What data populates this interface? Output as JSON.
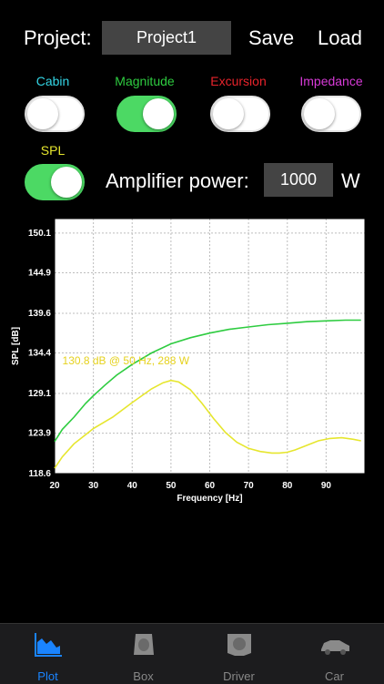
{
  "project": {
    "label": "Project:",
    "name": "Project1",
    "save_label": "Save",
    "load_label": "Load"
  },
  "toggles": [
    {
      "label": "Cabin",
      "color": "#33d6e6",
      "on": false
    },
    {
      "label": "Magnitude",
      "color": "#2ecc40",
      "on": true
    },
    {
      "label": "Excursion",
      "color": "#e8232b",
      "on": false
    },
    {
      "label": "Impedance",
      "color": "#d93bd9",
      "on": false
    },
    {
      "label": "SPL",
      "color": "#e6e62e",
      "on": true
    }
  ],
  "amplifier": {
    "label": "Amplifier power:",
    "value": "1000",
    "unit": "W"
  },
  "chart_data": {
    "type": "line",
    "xlabel": "Frequency [Hz]",
    "ylabel": "SPL [dB]",
    "xlim": [
      20,
      100
    ],
    "ylim": [
      118.6,
      152.0
    ],
    "xticks": [
      20,
      30,
      40,
      50,
      60,
      70,
      80,
      90
    ],
    "yticks": [
      118.6,
      123.9,
      129.1,
      134.4,
      139.6,
      144.9,
      150.1
    ],
    "grid": true,
    "annotation": "130.8 dB @ 50 Hz, 288 W",
    "series": [
      {
        "color": "#2ecc40",
        "x": [
          20,
          22,
          25,
          28,
          30,
          33,
          36,
          40,
          45,
          50,
          55,
          60,
          65,
          70,
          75,
          80,
          85,
          90,
          95,
          99
        ],
        "y": [
          122.8,
          124.4,
          126.0,
          127.8,
          128.8,
          130.2,
          131.5,
          132.9,
          134.4,
          135.6,
          136.4,
          137.0,
          137.5,
          137.8,
          138.1,
          138.3,
          138.5,
          138.6,
          138.7,
          138.7
        ]
      },
      {
        "color": "#e6e62e",
        "x": [
          20,
          22,
          25,
          28,
          30,
          35,
          40,
          45,
          48,
          50,
          52,
          55,
          58,
          61,
          64,
          67,
          70,
          73,
          76,
          78,
          80,
          82,
          85,
          88,
          91,
          94,
          97,
          99
        ],
        "y": [
          119.3,
          120.8,
          122.5,
          123.7,
          124.5,
          126.0,
          127.9,
          129.7,
          130.5,
          130.8,
          130.6,
          129.6,
          127.8,
          125.8,
          124.0,
          122.7,
          121.9,
          121.5,
          121.3,
          121.3,
          121.4,
          121.7,
          122.3,
          122.9,
          123.2,
          123.3,
          123.1,
          122.9
        ]
      }
    ]
  },
  "tabs": [
    {
      "label": "Plot",
      "active": true
    },
    {
      "label": "Box",
      "active": false
    },
    {
      "label": "Driver",
      "active": false
    },
    {
      "label": "Car",
      "active": false
    }
  ]
}
